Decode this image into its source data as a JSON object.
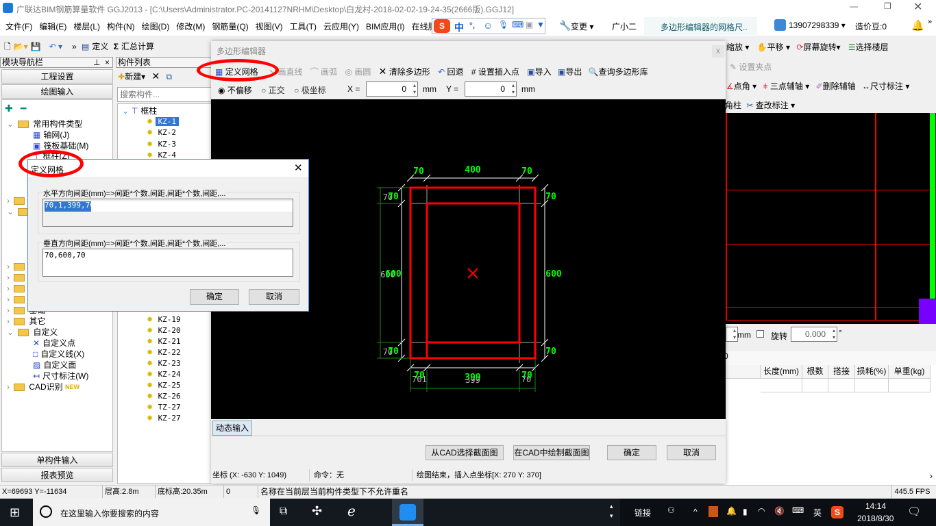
{
  "app": {
    "title": "广联达BIM钢筋算量软件 GGJ2013 - [C:\\Users\\Administrator.PC-20141127NRHM\\Desktop\\白龙村-2018-02-02-19-24-35(2666版).GGJ12]"
  },
  "menu": [
    "文件(F)",
    "编辑(E)",
    "楼层(L)",
    "构件(N)",
    "绘图(D)",
    "修改(M)",
    "钢筋量(Q)",
    "视图(V)",
    "工具(T)",
    "云应用(Y)",
    "BIM应用(I)",
    "在线服"
  ],
  "ime": {
    "lang": "中",
    "punct": "°,"
  },
  "menu_right": {
    "change": "变更",
    "assistant": "广小二",
    "notice": "多边形编辑器的网格尺..",
    "user": "13907298339",
    "beans": "造价豆:0"
  },
  "toolbar": {
    "define": "定义",
    "sum": "汇总计算"
  },
  "right_toolbar": {
    "zoom": "缩放",
    "pan": "平移",
    "rotate": "屏幕旋转",
    "floor": "选择楼层",
    "grip": "设置夹点",
    "corner": "点角",
    "three_axis": "三点辅轴",
    "del_axis": "删除辅轴",
    "dim": "尺寸标注",
    "corner_col": "角柱",
    "edit_dim": "查改标注"
  },
  "right_props": {
    "unit": "mm",
    "rotate_label": "旋转",
    "rotate_value": "0.000",
    "degree": "°",
    "row_value": "0"
  },
  "rebar_table": {
    "headers": [
      "长度(mm)",
      "根数",
      "搭接",
      "损耗(%)",
      "单重(kg)"
    ]
  },
  "nav": {
    "title": "模块导航栏",
    "project_settings": "工程设置",
    "drawing_input": "绘图输入",
    "single_input": "单构件输入",
    "report_preview": "报表预览",
    "tree": [
      "常用构件类型",
      "轴网(J)",
      "筏板基础(M)",
      "框柱(Z)",
      "其它",
      "自定义",
      "自定义点",
      "自定义线(X)",
      "自定义面",
      "尺寸标注(W)",
      "CAD识别",
      "基础"
    ],
    "new_badge": "NEW"
  },
  "components": {
    "title": "构件列表",
    "new": "新建",
    "search_placeholder": "搜索构件...",
    "root": "框柱",
    "items": [
      "KZ-1",
      "KZ-2",
      "KZ-3",
      "KZ-4",
      "KZ-19",
      "KZ-20",
      "KZ-21",
      "KZ-22",
      "KZ-23",
      "KZ-24",
      "KZ-25",
      "KZ-26",
      "TZ-27",
      "KZ-27"
    ],
    "selected": "KZ-1"
  },
  "poly_editor": {
    "title": "多边形编辑器",
    "close": "x",
    "tools": [
      "定义网格",
      "画直线",
      "画弧",
      "画圆",
      "清除多边形",
      "回退",
      "设置插入点",
      "导入",
      "导出",
      "查询多边形库"
    ],
    "modes": [
      "不偏移",
      "正交",
      "极坐标"
    ],
    "selected_mode": "不偏移",
    "x_label": "X =",
    "x_value": "0",
    "y_label": "Y =",
    "y_value": "0",
    "unit": "mm",
    "dynamic_input": "动态输入",
    "from_cad": "从CAD选择截面图",
    "draw_in_cad": "在CAD中绘制截面图",
    "ok": "确定",
    "cancel": "取消",
    "status": {
      "coord": "坐标 (X: -630 Y: 1049)",
      "command": "命令：无",
      "message": "绘图结束，插入点坐标[X: 270 Y: 370]"
    },
    "dims": {
      "top": [
        "70",
        "400",
        "70"
      ],
      "right": [
        "70",
        "600",
        "70"
      ],
      "left": [
        "70",
        "600",
        "70"
      ],
      "left_gray": [
        "70",
        "600",
        "70"
      ],
      "bottom": [
        "70",
        "399",
        "70"
      ],
      "bottom_gray": [
        "701",
        "399",
        "70"
      ]
    }
  },
  "grid_dialog": {
    "title": "定义网格",
    "h_label": "水平方向间距(mm)=>间距*个数,间距,间距*个数,间距,...",
    "h_value": "70,1,399,70",
    "v_label": "垂直方向间距(mm)=>间距*个数,间距,间距*个数,间距,...",
    "v_value": "70,600,70",
    "ok": "确定",
    "cancel": "取消"
  },
  "statusbar": {
    "coord": "X=69693 Y=-11634",
    "floor_height": "层高:2.8m",
    "bottom_elev": "底标高:20.35m",
    "value": "0",
    "message": "名称在当前层当前构件类型下不允许重名",
    "fps": "445.5 FPS"
  },
  "taskbar": {
    "search": "在这里输入你要搜索的内容",
    "link": "链接",
    "ime": "英",
    "time": "14:14",
    "date": "2018/8/30"
  },
  "colors": {
    "outline": "#ff0000",
    "dim_text": "#00ff00",
    "canvas": "#000000",
    "annotation": "#ff0000",
    "selection": "#3377d0"
  }
}
